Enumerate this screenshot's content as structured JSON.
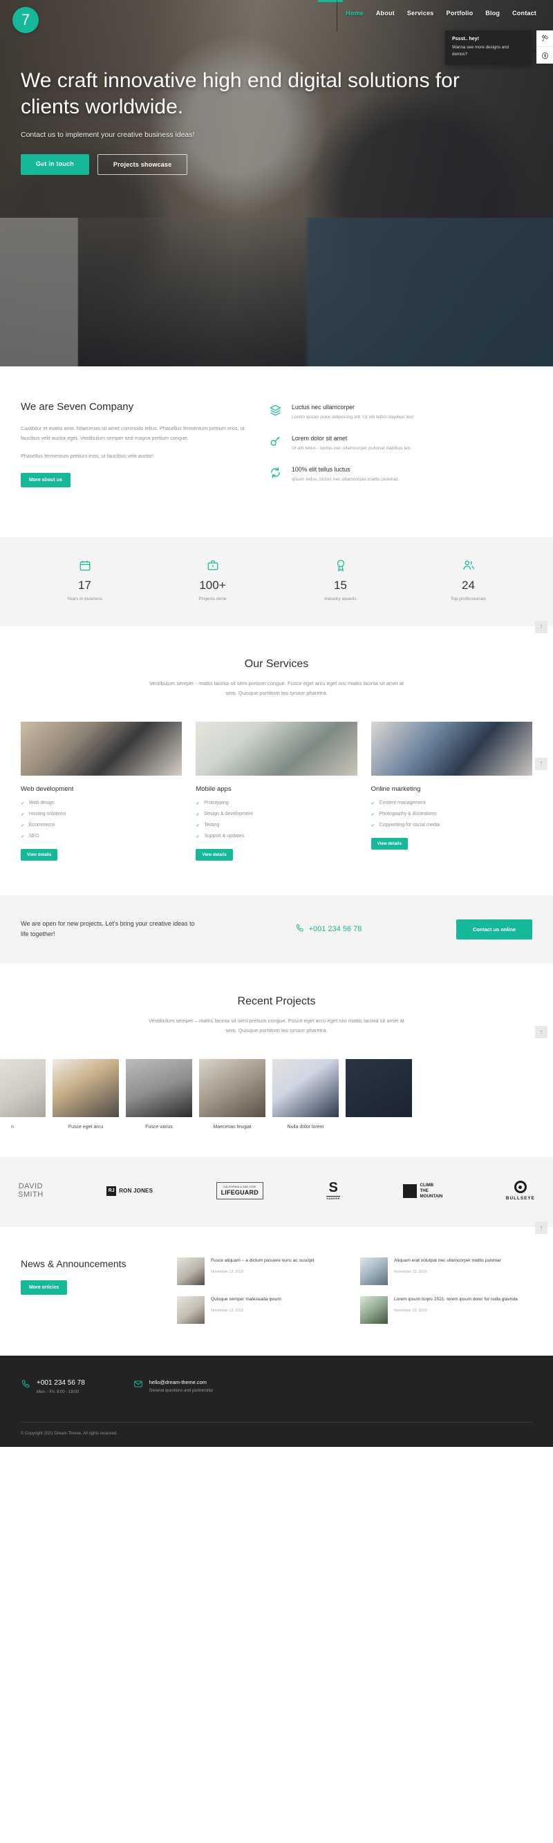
{
  "brand": {
    "logo_text": "7",
    "accent": "#16b89a"
  },
  "nav": {
    "items": [
      {
        "label": "Home",
        "active": true
      },
      {
        "label": "About",
        "active": false
      },
      {
        "label": "Services",
        "active": false
      },
      {
        "label": "Portfolio",
        "active": false
      },
      {
        "label": "Blog",
        "active": false
      },
      {
        "label": "Contact",
        "active": false
      }
    ]
  },
  "promo": {
    "title": "Pssst.. hey!",
    "text": "Wanna see more designs and demos?",
    "tools_icon": "tools-icon",
    "price_icon": "dollar-icon"
  },
  "hero": {
    "title": "We craft innovative high end digital solutions for clients worldwide.",
    "subtitle": "Contact us to implement your creative business ideas!",
    "primary_button": "Get in touch",
    "secondary_button": "Projects showcase"
  },
  "about": {
    "title": "We are Seven Company",
    "paragraph1": "Curabitur et mattis ante. Maecenas sit amet commodo tellus. Phasellus fermentum pretium eros, ut faucibus velit auctor eget. Vestibulum semper sed magna pretium congue.",
    "paragraph2": "Phasellus fermentum pretium eros, ut faucibus velit auctor!",
    "button": "More about us",
    "features": [
      {
        "icon": "layers-icon",
        "title": "Luctus nec ullamcorper",
        "text": "Lorem ipsum dolor adipiscing elit. Ut elit tellus dapibus leo!"
      },
      {
        "icon": "key-icon",
        "title": "Lorem dolor sit amet",
        "text": "Ut elit tellus - luctus nec ullamcorper pulvinar dapibus leo."
      },
      {
        "icon": "refresh-icon",
        "title": "100% elit tellus luctus",
        "text": "Ipsum tellus, luctus nec ullamcorper mattis pulvinar."
      }
    ]
  },
  "stats": {
    "items": [
      {
        "icon": "calendar-icon",
        "number": "17",
        "label": "Years in business"
      },
      {
        "icon": "briefcase-icon",
        "number": "100+",
        "label": "Projects done"
      },
      {
        "icon": "award-icon",
        "number": "15",
        "label": "Industry awards"
      },
      {
        "icon": "people-icon",
        "number": "24",
        "label": "Top professionals"
      }
    ]
  },
  "services": {
    "title": "Our Services",
    "subtitle": "Vestibulum semper - mattis lacinia sit sem pretium congue. Fusce eget arcu eget nisi mattis lacinia sit amet at sem. Quisque porttitum leo ornare pharetra.",
    "cards": [
      {
        "title": "Web development",
        "items": [
          "Web design",
          "Hosting solutions",
          "Ecommerce",
          "SEO"
        ],
        "button": "View details"
      },
      {
        "title": "Mobile apps",
        "items": [
          "Prototyping",
          "Design & development",
          "Testing",
          "Support & updates"
        ],
        "button": "View details"
      },
      {
        "title": "Online marketing",
        "items": [
          "Content management",
          "Photography & illustrations",
          "Copywriting for social media"
        ],
        "button": "View details"
      }
    ]
  },
  "cta": {
    "text": "We are open for new projects. Let's bring your creative ideas to life together!",
    "phone": "+001 234 56 78",
    "phone_icon": "phone-icon",
    "button": "Contact us online"
  },
  "projects": {
    "title": "Recent Projects",
    "subtitle": "Vestibulum semper – mattis lacinia sit sem pretium congue. Fusce eget arcu eget nisi mattis lacinia sit amet at sem. Quisque porttitum leo ornare pharetra.",
    "items": [
      {
        "name": "n"
      },
      {
        "name": "Fusce eget arcu"
      },
      {
        "name": "Fusce varius"
      },
      {
        "name": "Maecenas feugiat"
      },
      {
        "name": "Nulla dolor lorem"
      },
      {
        "name": ""
      }
    ]
  },
  "clients": {
    "logos": [
      {
        "name": "david-smith",
        "line1": "DAVID",
        "line2": "SMITH"
      },
      {
        "name": "ron-jones",
        "badge": "RJ",
        "label": "RON JONES"
      },
      {
        "name": "lifeguard",
        "small": "CALIFORNIA & SAN JOSE",
        "label": "LIFEGUARD"
      },
      {
        "name": "sander",
        "letter": "S",
        "label": "SANDER"
      },
      {
        "name": "climb-the-mountain",
        "line1": "CLIMB",
        "line2": "THE",
        "line3": "MOUNTAIN"
      },
      {
        "name": "bullseye",
        "label": "BULLSEYE"
      }
    ]
  },
  "news": {
    "title": "News & Announcements",
    "button": "More articles",
    "posts": [
      {
        "title": "Fusce aliquam – a dictum posuere nunc ac suscipit",
        "date": "November 13, 2019"
      },
      {
        "title": "Aliquam erat volutpat nec ullamcorper mattis pulvinar",
        "date": "November 13, 2019"
      },
      {
        "title": "Quisque semper malesuada ipsum",
        "date": "November 13, 2019"
      },
      {
        "title": "Lorem ipsum turpis 2021: lorem ipsum dolor for nulla glavrida",
        "date": "November 13, 2019"
      }
    ]
  },
  "footer": {
    "phone": "+001 234 56 78",
    "hours": "Mon. - Fri. 9:00 - 19:00",
    "email": "hello@dream-theme.com",
    "email_note": "General questions and partnership",
    "copyright": "© Copyright 2021 Dream-Theme. All rights reserved.",
    "phone_icon": "phone-icon",
    "mail_icon": "mail-icon"
  },
  "to_top": {
    "label": "↑"
  }
}
